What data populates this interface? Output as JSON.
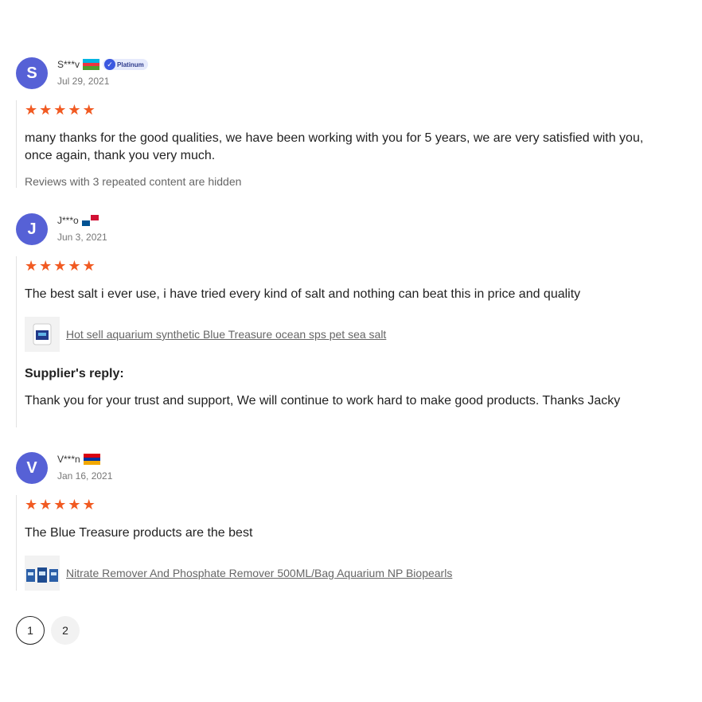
{
  "reviews": [
    {
      "initial": "S",
      "name": "S***v",
      "flag": "azerbaijan",
      "badge": "Platinum",
      "date": "Jul 29, 2021",
      "stars": 5,
      "text": "many thanks for the good qualities, we have been working with you for 5 years, we are very satisfied with you, once again, thank you very much.",
      "hidden_note": "Reviews with 3 repeated content are hidden"
    },
    {
      "initial": "J",
      "name": "J***o",
      "flag": "panama",
      "date": "Jun 3, 2021",
      "stars": 5,
      "text": "The best salt i ever use, i have tried every kind of salt and nothing can beat this in price and quality",
      "product": "Hot sell aquarium synthetic Blue Treasure ocean sps pet sea salt",
      "reply_title": "Supplier's reply:",
      "reply_text": "Thank you for your trust and support, We will continue to work hard to make good products. Thanks Jacky"
    },
    {
      "initial": "V",
      "name": "V***n",
      "flag": "armenia",
      "date": "Jan 16, 2021",
      "stars": 5,
      "text": "The Blue Treasure products are the best",
      "product": "Nitrate Remover And Phosphate Remover 500ML/Bag Aquarium NP Biopearls"
    }
  ],
  "pagination": {
    "pages": [
      "1",
      "2"
    ],
    "current": "1"
  },
  "colors": {
    "avatar": "#5661d6",
    "star": "#f15a22",
    "badge_bg": "#e6eafc"
  },
  "icons": {
    "star": "star-icon",
    "verified": "verified-check-icon"
  }
}
